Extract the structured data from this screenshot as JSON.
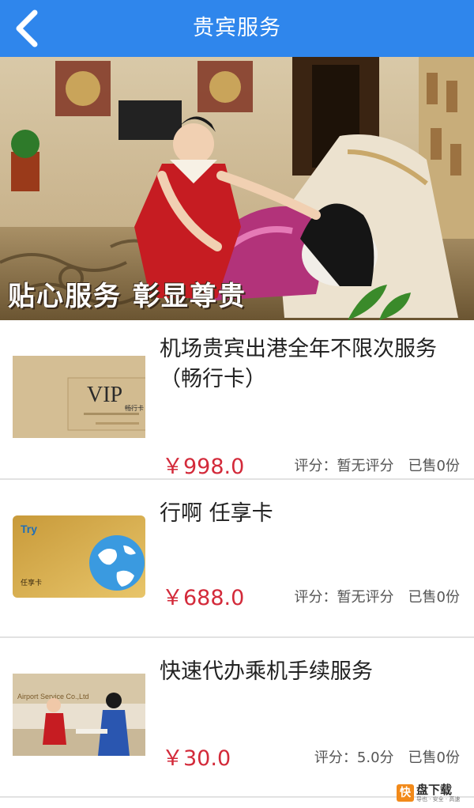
{
  "header": {
    "title": "贵宾服务",
    "back_icon": "chevron-left-icon"
  },
  "banner": {
    "caption": "贴心服务  彰显尊贵"
  },
  "items": [
    {
      "name": "机场贵宾出港全年不限次服务（畅行卡）",
      "price": "￥998.0",
      "rating": "评分：暂无评分",
      "sold": "已售0份",
      "thumb_text": "VIP",
      "thumb_sub": "畅行卡"
    },
    {
      "name": "行啊 任享卡",
      "price": "￥688.0",
      "rating": "评分：暂无评分",
      "sold": "已售0份",
      "thumb_text": "Try",
      "thumb_sub": "任享卡"
    },
    {
      "name": "快速代办乘机手续服务",
      "price": "￥30.0",
      "rating": "评分：5.0分",
      "sold": "已售0份",
      "thumb_text": "Airport Service Co.,Ltd",
      "thumb_sub": ""
    }
  ],
  "watermark": {
    "box": "快",
    "text": "盘下载",
    "sub": "导也 · 安全 · 高速"
  },
  "colors": {
    "header_bg": "#2f86ec",
    "price": "#d32a3a",
    "divider": "#e2e2e2"
  }
}
